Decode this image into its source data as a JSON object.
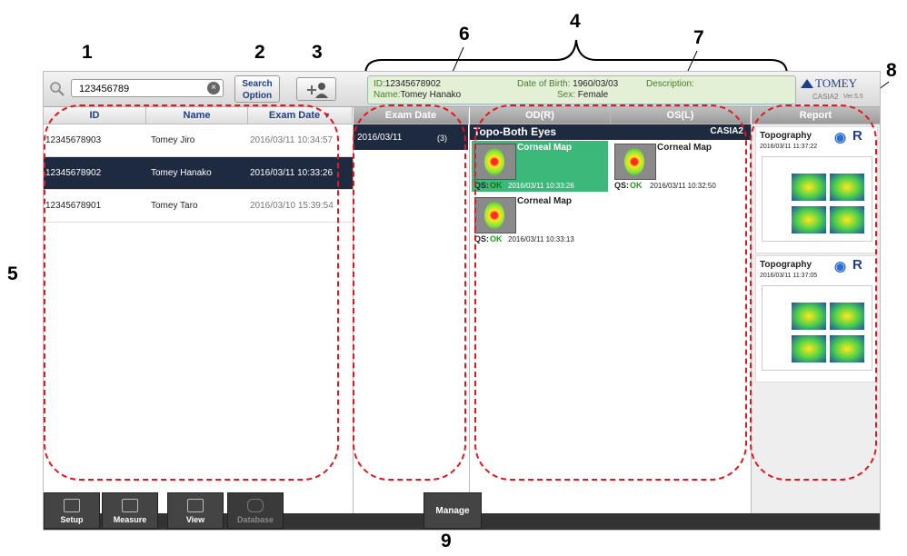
{
  "callouts": {
    "c1": "1",
    "c2": "2",
    "c3": "3",
    "c4": "4",
    "c5": "5",
    "c6": "6",
    "c7": "7",
    "c8": "8",
    "c9": "9"
  },
  "search": {
    "value": "123456789",
    "clear_icon": "×"
  },
  "search_option": {
    "line1": "Search",
    "line2": "Option"
  },
  "patient": {
    "id_label": "ID:",
    "id": "12345678902",
    "name_label": "Name:",
    "name": "Tomey Hanako",
    "dob_label": "Date of Birth:",
    "dob": "1960/03/03",
    "sex_label": "Sex:",
    "sex": "Female",
    "desc_label": "Description:"
  },
  "brand": {
    "logo": "TOMEY",
    "model": "CASIA2",
    "version": "Ver.5.5"
  },
  "patient_list": {
    "headers": {
      "id": "ID",
      "name": "Name",
      "exam_date": "Exam Date"
    },
    "rows": [
      {
        "id": "12345678903",
        "name": "Tomey Jiro",
        "date": "2016/03/11 10:34:57"
      },
      {
        "id": "12345678902",
        "name": "Tomey Hanako",
        "date": "2016/03/11 10:33:26"
      },
      {
        "id": "12345678901",
        "name": "Tomey Taro",
        "date": "2016/03/10 15:39:54"
      }
    ]
  },
  "exam_dates": {
    "header": "Exam Date",
    "items": [
      {
        "date": "2016/03/11",
        "count": "(3)"
      }
    ]
  },
  "eyes": {
    "od": "OD(R)",
    "os": "OS(L)"
  },
  "exam_group": {
    "title": "Topo-Both Eyes",
    "device": "CASIA2",
    "items": [
      {
        "name": "Corneal Map",
        "qs": "QS:",
        "qs_status": "OK",
        "time": "2016/03/11 10:33:26"
      },
      {
        "name": "Corneal Map",
        "qs": "QS:",
        "qs_status": "OK",
        "time": "2016/03/11 10:32:50"
      },
      {
        "name": "Corneal Map",
        "qs": "QS:",
        "qs_status": "OK",
        "time": "2016/03/11 10:33:13"
      }
    ]
  },
  "report": {
    "header": "Report",
    "items": [
      {
        "title": "Topography",
        "time": "2016/03/11 11:37:22",
        "eye": "R"
      },
      {
        "title": "Topography",
        "time": "2016/03/11 11:37:05",
        "eye": "R"
      }
    ]
  },
  "nav": {
    "setup": "Setup",
    "measure": "Measure",
    "view": "View",
    "database": "Database",
    "manage": "Manage"
  },
  "colors": {
    "accent": "#1f3f87",
    "selected": "#1e2a40",
    "highlight": "#3cb87a",
    "dashed": "#e8141e",
    "ok": "#1ca01c"
  }
}
